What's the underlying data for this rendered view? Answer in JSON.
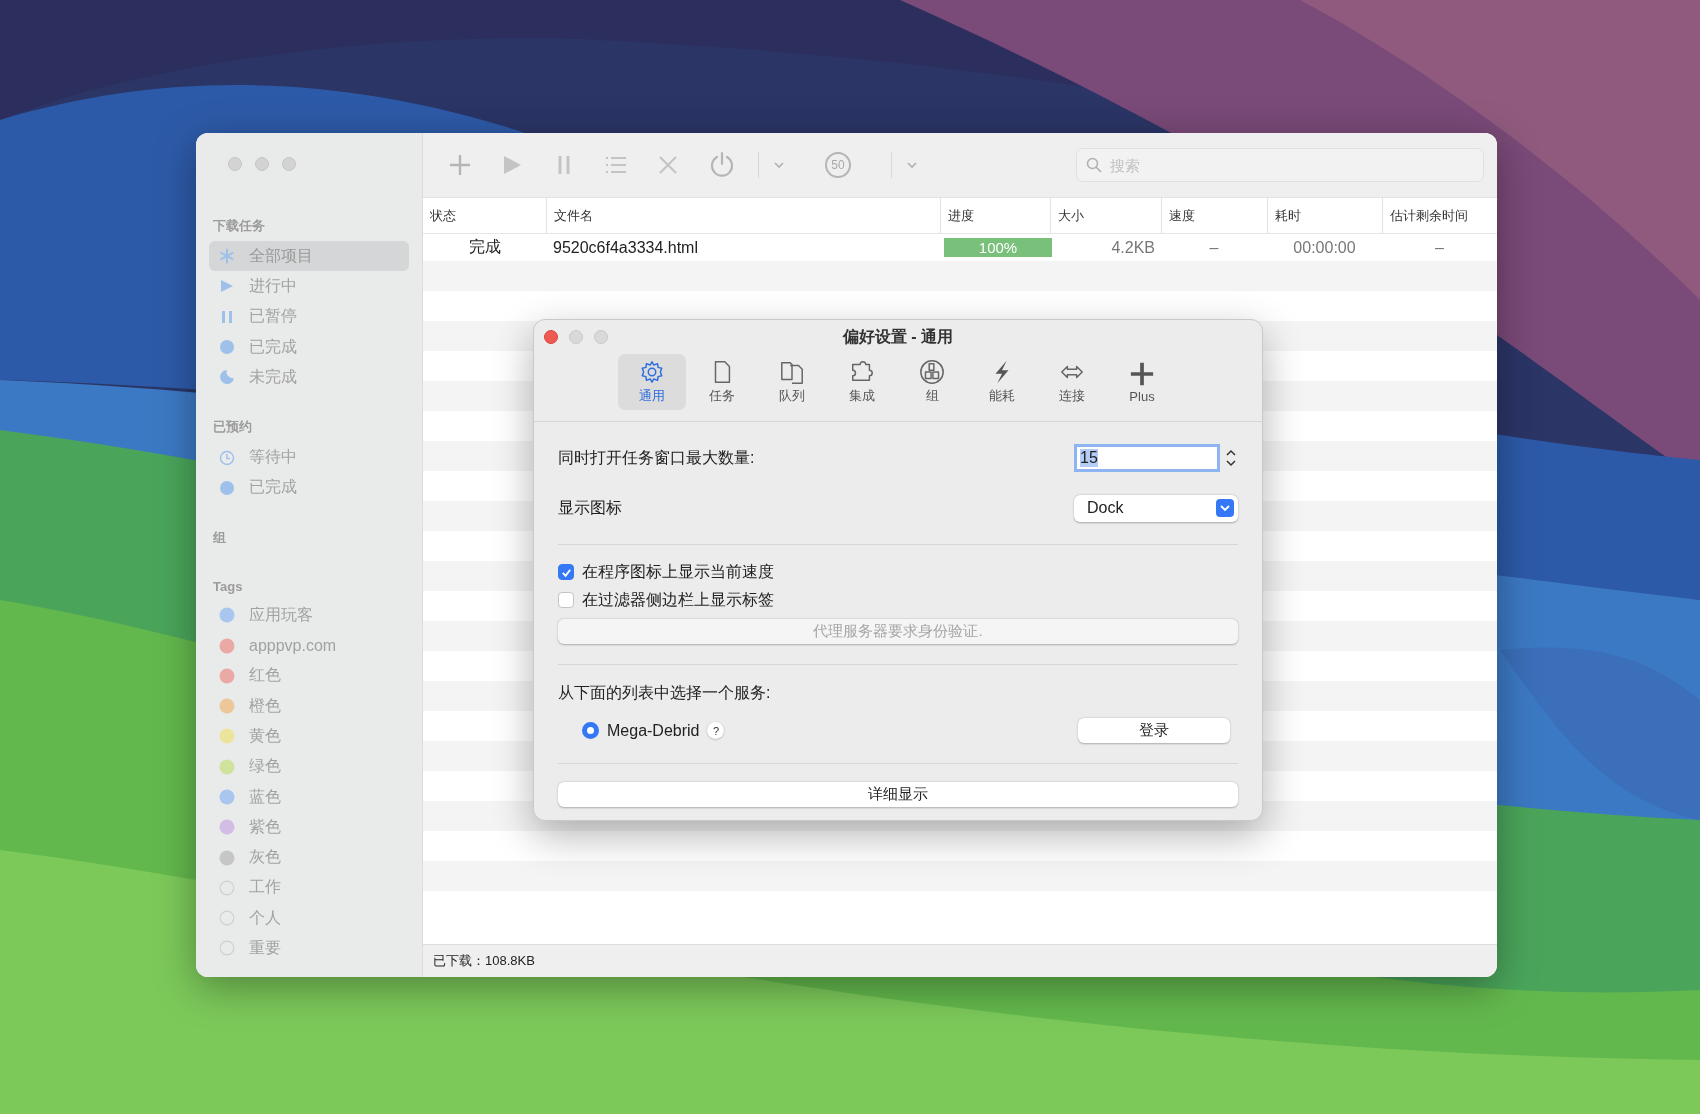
{
  "sidebar": {
    "sections": [
      {
        "title": "下载任务",
        "items": [
          {
            "label": "全部项目",
            "kind": "asterisk",
            "selected": true
          },
          {
            "label": "进行中",
            "kind": "play",
            "selected": false
          },
          {
            "label": "已暂停",
            "kind": "pause",
            "selected": false
          },
          {
            "label": "已完成",
            "kind": "circle",
            "selected": false
          },
          {
            "label": "未完成",
            "kind": "moon",
            "selected": false
          }
        ]
      },
      {
        "title": "已预约",
        "items": [
          {
            "label": "等待中",
            "kind": "clock",
            "selected": false
          },
          {
            "label": "已完成",
            "kind": "circle",
            "selected": false
          }
        ]
      },
      {
        "title": "组"
      },
      {
        "title": "Tags",
        "items": [
          {
            "label": "应用玩客",
            "kind": "tag",
            "color": "#a9c6ef",
            "selected": false
          },
          {
            "label": "apppvp.com",
            "kind": "tag",
            "color": "#eba9a5",
            "selected": false
          },
          {
            "label": "红色",
            "kind": "tag",
            "color": "#eba9a5",
            "selected": false
          },
          {
            "label": "橙色",
            "kind": "tag",
            "color": "#ecc79a",
            "selected": false
          },
          {
            "label": "黄色",
            "kind": "tag",
            "color": "#ece49a",
            "selected": false
          },
          {
            "label": "绿色",
            "kind": "tag",
            "color": "#cfe29e",
            "selected": false
          },
          {
            "label": "蓝色",
            "kind": "tag",
            "color": "#a9c6ef",
            "selected": false
          },
          {
            "label": "紫色",
            "kind": "tag",
            "color": "#d3bde6",
            "selected": false
          },
          {
            "label": "灰色",
            "kind": "tag",
            "color": "#c6c6c6",
            "selected": false
          },
          {
            "label": "工作",
            "kind": "ring",
            "selected": false
          },
          {
            "label": "个人",
            "kind": "ring",
            "selected": false
          },
          {
            "label": "重要",
            "kind": "ring",
            "selected": false
          }
        ]
      }
    ]
  },
  "toolbar": {
    "speed_limit": "50",
    "search": {
      "placeholder": "搜索"
    }
  },
  "table": {
    "columns": [
      "状态",
      "文件名",
      "进度",
      "大小",
      "速度",
      "耗时",
      "估计剩余时间"
    ],
    "rows": [
      {
        "status": "完成",
        "file": "9520c6f4a3334.html",
        "level": 1,
        "progress": "100%",
        "size": "4.2KB",
        "speed": "–",
        "elapsed": "00:00:00",
        "remaining": "–"
      }
    ]
  },
  "status_bar": "已下载：108.8KB",
  "dialog": {
    "title": "偏好设置 - 通用",
    "tabs": [
      {
        "label": "通用",
        "kind": "gear",
        "selected": true
      },
      {
        "label": "任务",
        "kind": "page",
        "selected": false
      },
      {
        "label": "队列",
        "kind": "pages",
        "selected": false
      },
      {
        "label": "集成",
        "kind": "puzzle",
        "selected": false
      },
      {
        "label": "组",
        "kind": "group",
        "selected": false
      },
      {
        "label": "能耗",
        "kind": "bolt",
        "selected": false
      },
      {
        "label": "连接",
        "kind": "arrows",
        "selected": false
      },
      {
        "label": "Plus",
        "kind": "plus",
        "selected": false
      }
    ],
    "max_windows": {
      "label": "同时打开任务窗口最大数量:",
      "value": "15"
    },
    "show_icon": {
      "label": "显示图标",
      "value": "Dock"
    },
    "checkboxes": [
      {
        "label": "在程序图标上显示当前速度",
        "checked": true
      },
      {
        "label": "在过滤器侧边栏上显示标签",
        "checked": false
      }
    ],
    "proxy_button": {
      "label": "代理服务器要求身份验证.",
      "disabled": true
    },
    "service_label": "从下面的列表中选择一个服务:",
    "services": [
      {
        "label": "Mega-Debrid",
        "selected": true,
        "help": "?"
      }
    ],
    "login_button": "登录",
    "details_button": "详细显示"
  }
}
